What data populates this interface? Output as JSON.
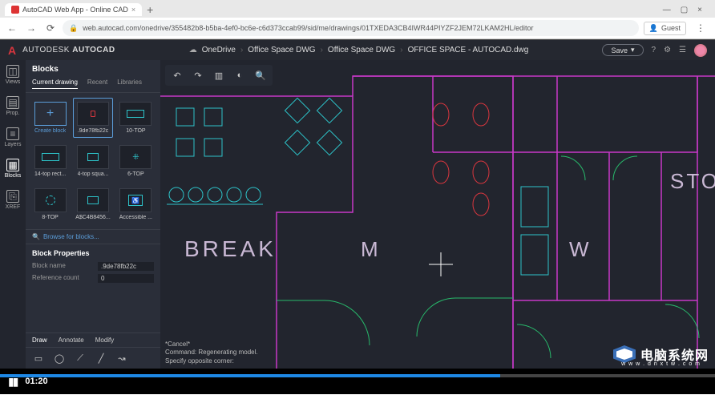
{
  "browser": {
    "tab_title": "AutoCAD Web App - Online CAD",
    "url": "web.autocad.com/onedrive/355482b8-b5ba-4ef0-bc6e-c6d373ccab99/sid/me/drawings/01TXEDA3CB4IWR44PIYZF2JEM72LKAM2HL/editor",
    "guest_label": "Guest"
  },
  "appbar": {
    "brand_prefix": "AUTODESK",
    "brand_product": "AUTOCAD",
    "breadcrumb": [
      "OneDrive",
      "Office Space DWG",
      "Office Space DWG",
      "OFFICE SPACE - AUTOCAD.dwg"
    ],
    "save": "Save"
  },
  "rail": {
    "items": [
      {
        "label": "Views"
      },
      {
        "label": "Prop."
      },
      {
        "label": "Layers"
      },
      {
        "label": "Blocks"
      },
      {
        "label": "XREF"
      }
    ],
    "selected": 3
  },
  "panel": {
    "title": "Blocks",
    "tabs": [
      "Current drawing",
      "Recent",
      "Libraries"
    ],
    "active_tab": 0,
    "blocks": [
      {
        "label": "Create block",
        "create": true
      },
      {
        "label": ".9de78fb22c",
        "selected": true
      },
      {
        "label": "10-TOP"
      },
      {
        "label": "14-top rect..."
      },
      {
        "label": "4-top squa..."
      },
      {
        "label": "6-TOP"
      },
      {
        "label": "8-TOP"
      },
      {
        "label": "A$C4B8456..."
      },
      {
        "label": "Accessible ..."
      }
    ],
    "browse": "Browse for blocks...",
    "properties_title": "Block Properties",
    "properties": [
      {
        "name": "Block name",
        "value": ".9de78fb22c"
      },
      {
        "name": "Reference count",
        "value": "0"
      }
    ],
    "tool_tabs": [
      "Draw",
      "Annotate",
      "Modify"
    ],
    "active_tool_tab": 0
  },
  "canvas": {
    "labels": {
      "break": "BREAK",
      "m": "M",
      "w": "W",
      "sto": "STO"
    },
    "cmd_lines": [
      "*Cancel*",
      "Command: Regenerating model.",
      "Specify opposite corner:"
    ]
  },
  "watermark": {
    "text": "电脑系统网",
    "sub": "w w w . d n x t w . c o m"
  },
  "player": {
    "time": "01:20",
    "progress_pct": 70
  }
}
